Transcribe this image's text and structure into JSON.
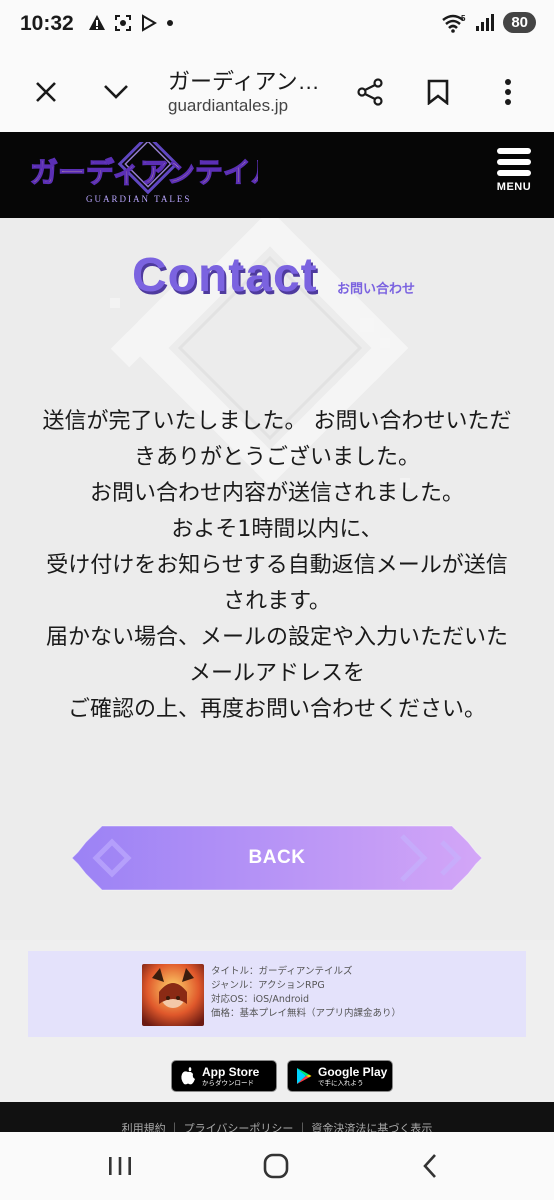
{
  "status_bar": {
    "time": "10:32",
    "battery": "80",
    "signal_label": "5"
  },
  "browser": {
    "title": "ガーディアン…",
    "url": "guardiantales.jp"
  },
  "site": {
    "logo_text": "ガーディアンテイルズ",
    "logo_subtext": "GUARDIAN TALES",
    "menu_label": "MENU"
  },
  "contact": {
    "title": "Contact",
    "subtitle": "お問い合わせ",
    "message_lines": [
      "送信が完了いたしました。 お問い合わせいただ",
      "きありがとうございました。",
      "お問い合わせ内容が送信されました。",
      "およそ1時間以内に、",
      "受け付けをお知らせする自動返信メールが送信",
      "されます。",
      "届かない場合、メールの設定や入力いただいた",
      "メールアドレスを",
      "ご確認の上、再度お問い合わせください。"
    ],
    "back_label": "BACK"
  },
  "footer": {
    "info": [
      "タイトル：ガーディアンテイルズ",
      "ジャンル：アクションRPG",
      "対応OS：iOS/Android",
      "価格：基本プレイ無料（アプリ内課金あり）"
    ],
    "app_store": {
      "name": "App Store",
      "sub": "からダウンロード"
    },
    "google_play": {
      "name": "Google Play",
      "sub": "で手に入れよう"
    },
    "links": "利用規約 ｜ プライバシーポリシー ｜ 資金決済法に基づく表示"
  },
  "colors": {
    "accent": "#7b63e0",
    "header_bg": "#060606",
    "button_gradient_start": "#9b82f5",
    "button_gradient_end": "#d3a6f7"
  }
}
